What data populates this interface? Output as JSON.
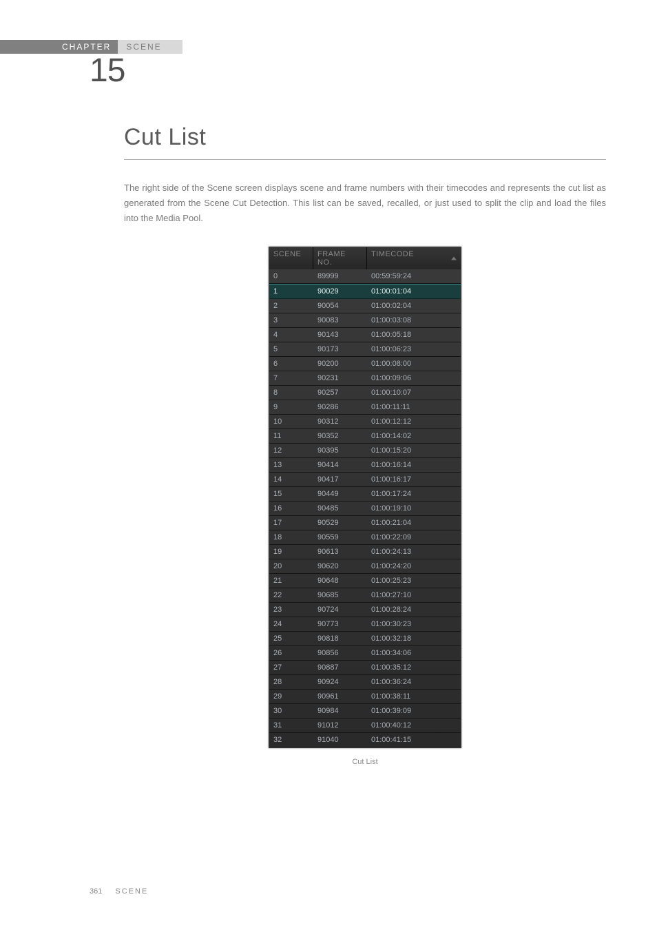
{
  "chapter": {
    "label": "CHAPTER",
    "section": "SCENE",
    "number": "15"
  },
  "heading": "Cut List",
  "paragraph": "The right side of the Scene screen displays scene and frame numbers with their timecodes and represents the cut list as generated from the Scene Cut Detection. This list can be saved, recalled, or just used to split the clip and load the files into the Media Pool.",
  "table": {
    "headers": {
      "scene": "SCENE",
      "frame": "FRAME NO.",
      "timecode": "TIMECODE"
    },
    "selected_index": 1,
    "rows": [
      {
        "scene": "0",
        "frame": "89999",
        "tc": "00:59:59:24"
      },
      {
        "scene": "1",
        "frame": "90029",
        "tc": "01:00:01:04"
      },
      {
        "scene": "2",
        "frame": "90054",
        "tc": "01:00:02:04"
      },
      {
        "scene": "3",
        "frame": "90083",
        "tc": "01:00:03:08"
      },
      {
        "scene": "4",
        "frame": "90143",
        "tc": "01:00:05:18"
      },
      {
        "scene": "5",
        "frame": "90173",
        "tc": "01:00:06:23"
      },
      {
        "scene": "6",
        "frame": "90200",
        "tc": "01:00:08:00"
      },
      {
        "scene": "7",
        "frame": "90231",
        "tc": "01:00:09:06"
      },
      {
        "scene": "8",
        "frame": "90257",
        "tc": "01:00:10:07"
      },
      {
        "scene": "9",
        "frame": "90286",
        "tc": "01:00:11:11"
      },
      {
        "scene": "10",
        "frame": "90312",
        "tc": "01:00:12:12"
      },
      {
        "scene": "11",
        "frame": "90352",
        "tc": "01:00:14:02"
      },
      {
        "scene": "12",
        "frame": "90395",
        "tc": "01:00:15:20"
      },
      {
        "scene": "13",
        "frame": "90414",
        "tc": "01:00:16:14"
      },
      {
        "scene": "14",
        "frame": "90417",
        "tc": "01:00:16:17"
      },
      {
        "scene": "15",
        "frame": "90449",
        "tc": "01:00:17:24"
      },
      {
        "scene": "16",
        "frame": "90485",
        "tc": "01:00:19:10"
      },
      {
        "scene": "17",
        "frame": "90529",
        "tc": "01:00:21:04"
      },
      {
        "scene": "18",
        "frame": "90559",
        "tc": "01:00:22:09"
      },
      {
        "scene": "19",
        "frame": "90613",
        "tc": "01:00:24:13"
      },
      {
        "scene": "20",
        "frame": "90620",
        "tc": "01:00:24:20"
      },
      {
        "scene": "21",
        "frame": "90648",
        "tc": "01:00:25:23"
      },
      {
        "scene": "22",
        "frame": "90685",
        "tc": "01:00:27:10"
      },
      {
        "scene": "23",
        "frame": "90724",
        "tc": "01:00:28:24"
      },
      {
        "scene": "24",
        "frame": "90773",
        "tc": "01:00:30:23"
      },
      {
        "scene": "25",
        "frame": "90818",
        "tc": "01:00:32:18"
      },
      {
        "scene": "26",
        "frame": "90856",
        "tc": "01:00:34:06"
      },
      {
        "scene": "27",
        "frame": "90887",
        "tc": "01:00:35:12"
      },
      {
        "scene": "28",
        "frame": "90924",
        "tc": "01:00:36:24"
      },
      {
        "scene": "29",
        "frame": "90961",
        "tc": "01:00:38:11"
      },
      {
        "scene": "30",
        "frame": "90984",
        "tc": "01:00:39:09"
      },
      {
        "scene": "31",
        "frame": "91012",
        "tc": "01:00:40:12"
      },
      {
        "scene": "32",
        "frame": "91040",
        "tc": "01:00:41:15"
      }
    ]
  },
  "caption": "Cut List",
  "footer": {
    "page": "361",
    "section": "SCENE"
  }
}
